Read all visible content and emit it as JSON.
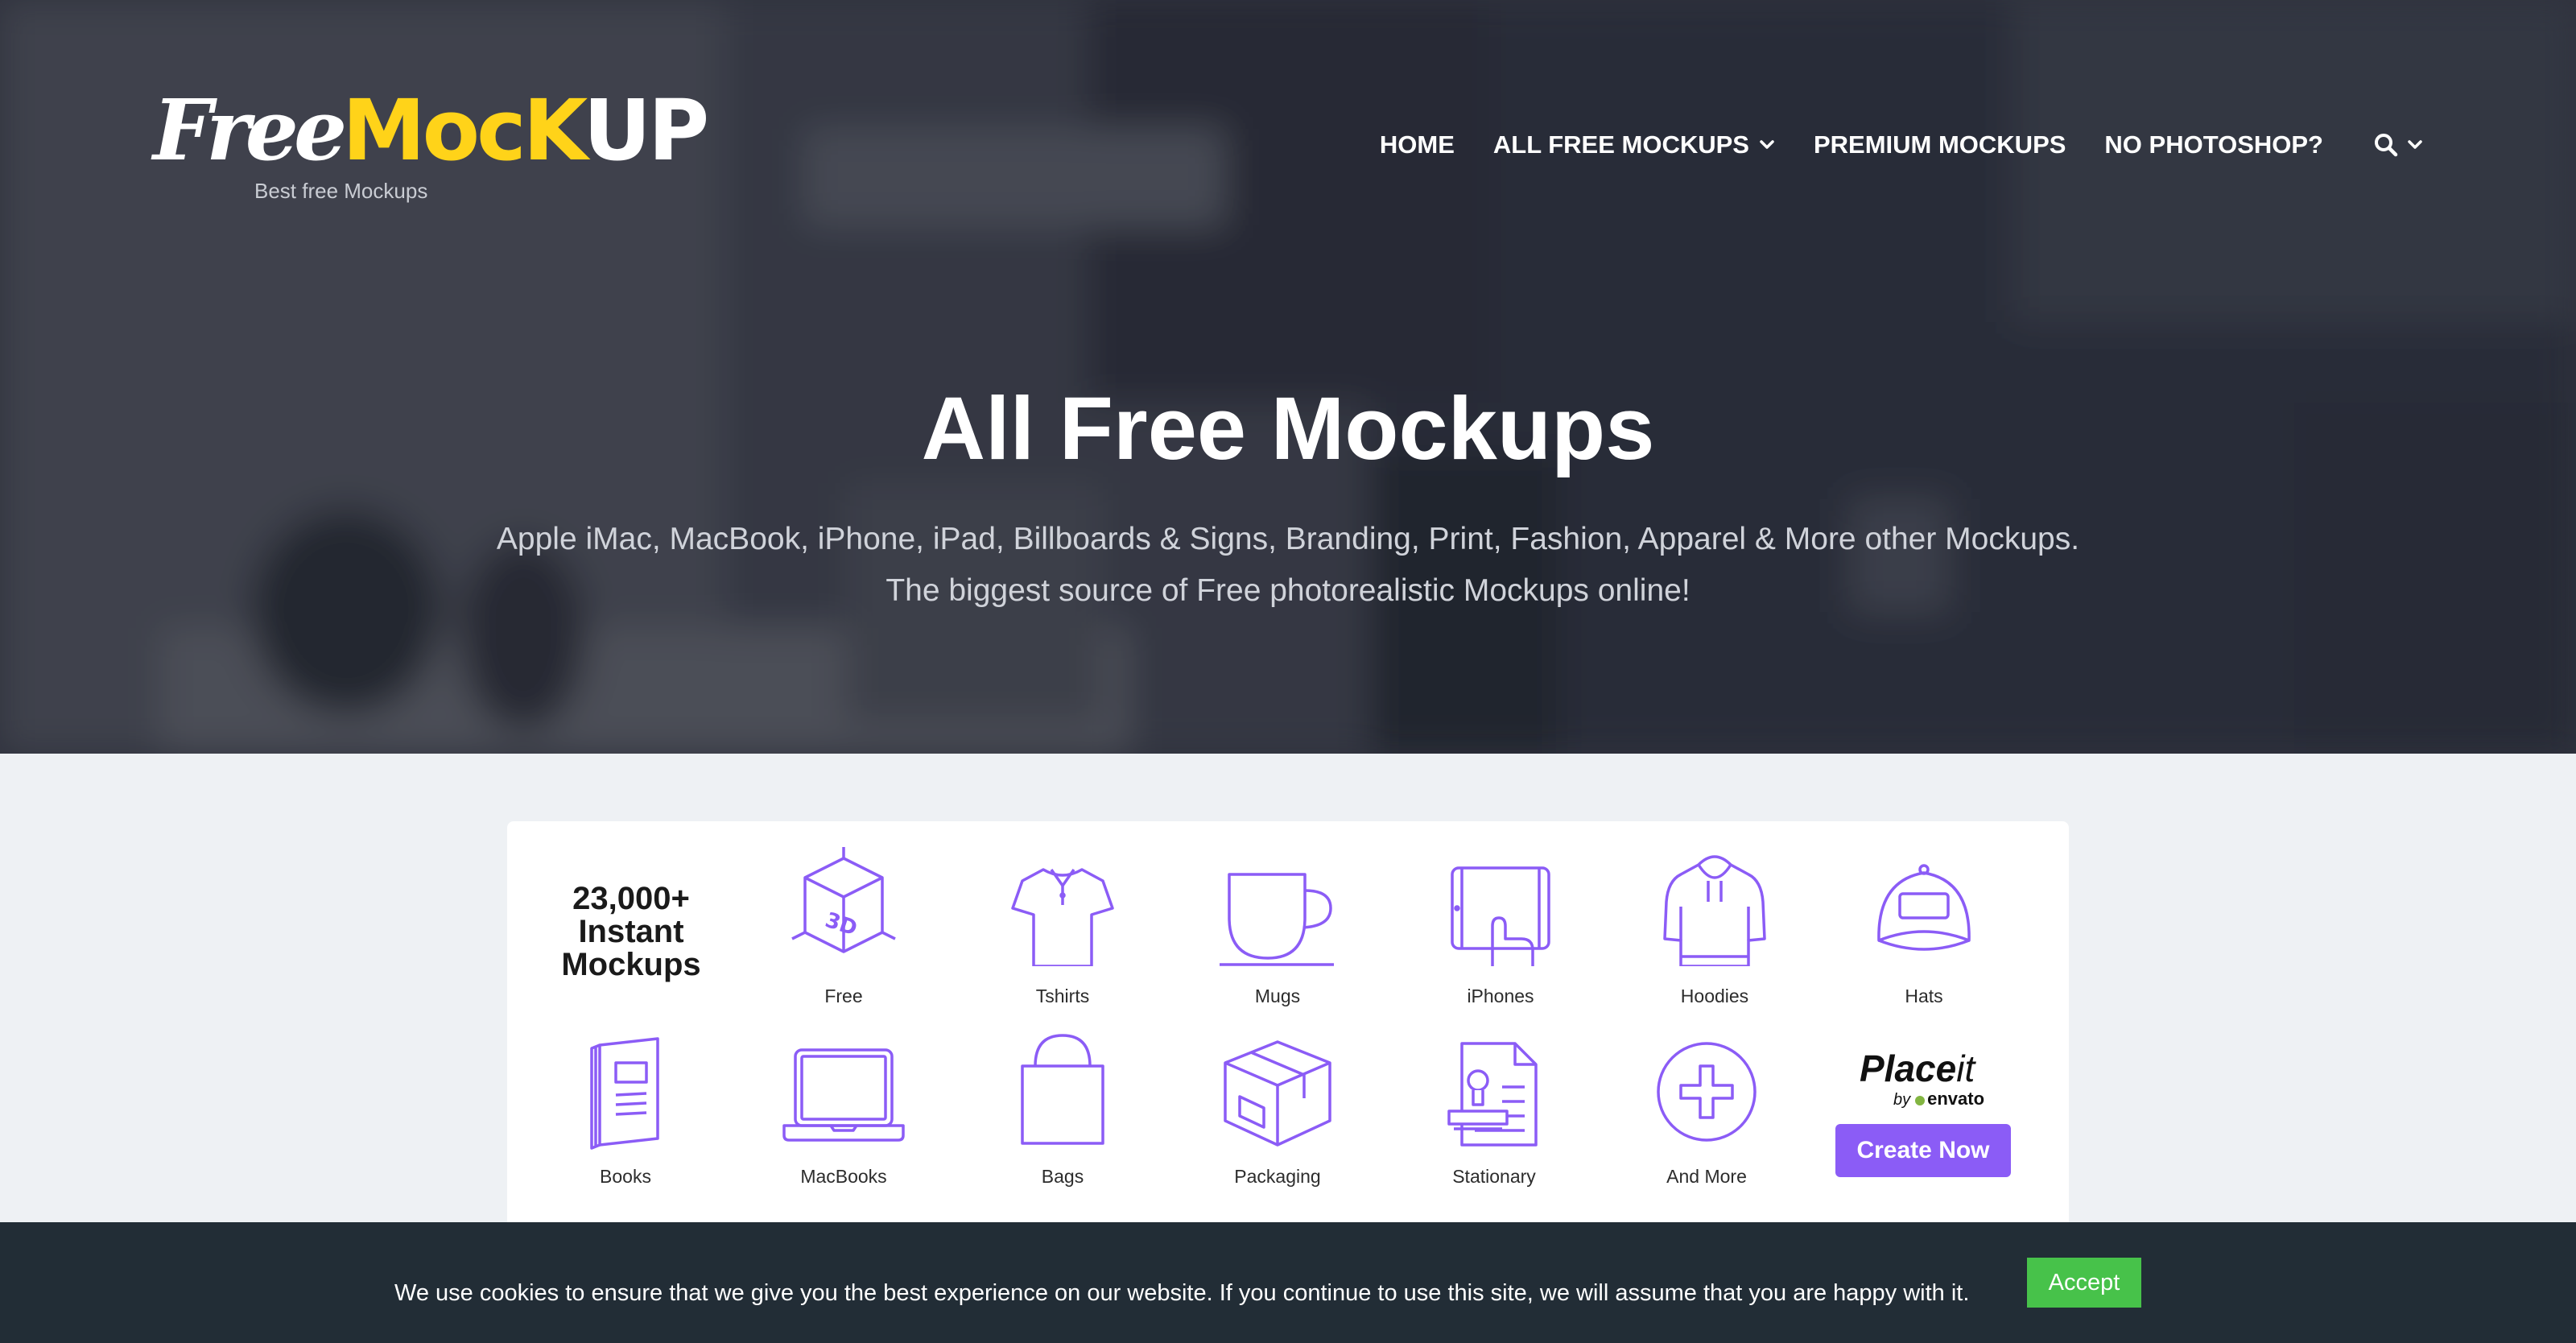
{
  "logo": {
    "part1": "Free",
    "part2": "MocK",
    "part3": "UP",
    "tagline": "Best free Mockups"
  },
  "nav": {
    "items": [
      {
        "label": "HOME"
      },
      {
        "label": "ALL FREE MOCKUPS"
      },
      {
        "label": "PREMIUM MOCKUPS"
      },
      {
        "label": "NO PHOTOSHOP?"
      }
    ],
    "search_icon": "search-icon"
  },
  "hero": {
    "title": "All Free Mockups",
    "subtitle_line1": "Apple iMac, MacBook, iPhone, iPad, Billboards & Signs, Branding, Print, Fashion, Apparel & More other Mockups.",
    "subtitle_line2": "The biggest source of Free photorealistic Mockups online!"
  },
  "categories": {
    "count_line1": "23,000+",
    "count_line2": "Instant",
    "count_line3": "Mockups",
    "items": [
      {
        "label": "Free",
        "icon": "3d-box-icon"
      },
      {
        "label": "Tshirts",
        "icon": "tshirt-icon"
      },
      {
        "label": "Mugs",
        "icon": "mug-icon"
      },
      {
        "label": "iPhones",
        "icon": "phone-hand-icon"
      },
      {
        "label": "Hoodies",
        "icon": "hoodie-icon"
      },
      {
        "label": "Hats",
        "icon": "hat-icon"
      },
      {
        "label": "Books",
        "icon": "book-icon"
      },
      {
        "label": "MacBooks",
        "icon": "laptop-icon"
      },
      {
        "label": "Bags",
        "icon": "bag-icon"
      },
      {
        "label": "Packaging",
        "icon": "package-icon"
      },
      {
        "label": "Stationary",
        "icon": "stationery-icon"
      },
      {
        "label": "And More",
        "icon": "plus-circle-icon"
      }
    ],
    "placeit_brand": "Place",
    "placeit_brand_light": "it",
    "placeit_by": "by",
    "placeit_envato": "envato",
    "cta": "Create Now",
    "accent_color": "#8b5cf6"
  },
  "cookie": {
    "message": "We use cookies to ensure that we give you the best experience on our website. If you continue to use this site, we will assume that you are happy with it.",
    "accept": "Accept"
  }
}
